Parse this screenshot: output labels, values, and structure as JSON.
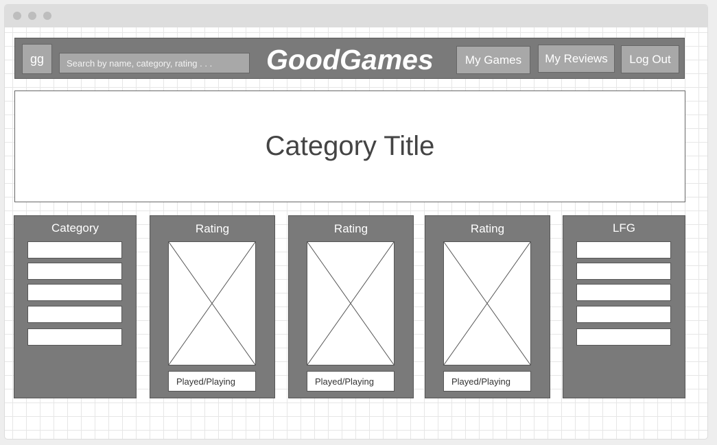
{
  "header": {
    "logo_text": "gg",
    "search_placeholder": "Search by name, category, rating . . .",
    "brand": "GoodGames",
    "nav": {
      "my_games": "My Games",
      "my_reviews": "My Reviews",
      "log_out": "Log Out"
    }
  },
  "hero": {
    "title": "Category Title"
  },
  "panels": {
    "category": {
      "title": "Category"
    },
    "ratings": [
      {
        "title": "Rating",
        "status": "Played/Playing"
      },
      {
        "title": "Rating",
        "status": "Played/Playing"
      },
      {
        "title": "Rating",
        "status": "Played/Playing"
      }
    ],
    "lfg": {
      "title": "LFG"
    }
  },
  "colors": {
    "header_bg": "#7a7a7a",
    "button_bg": "#a8a8a8",
    "panel_bg": "#7a7a7a",
    "hero_text": "#444444"
  }
}
